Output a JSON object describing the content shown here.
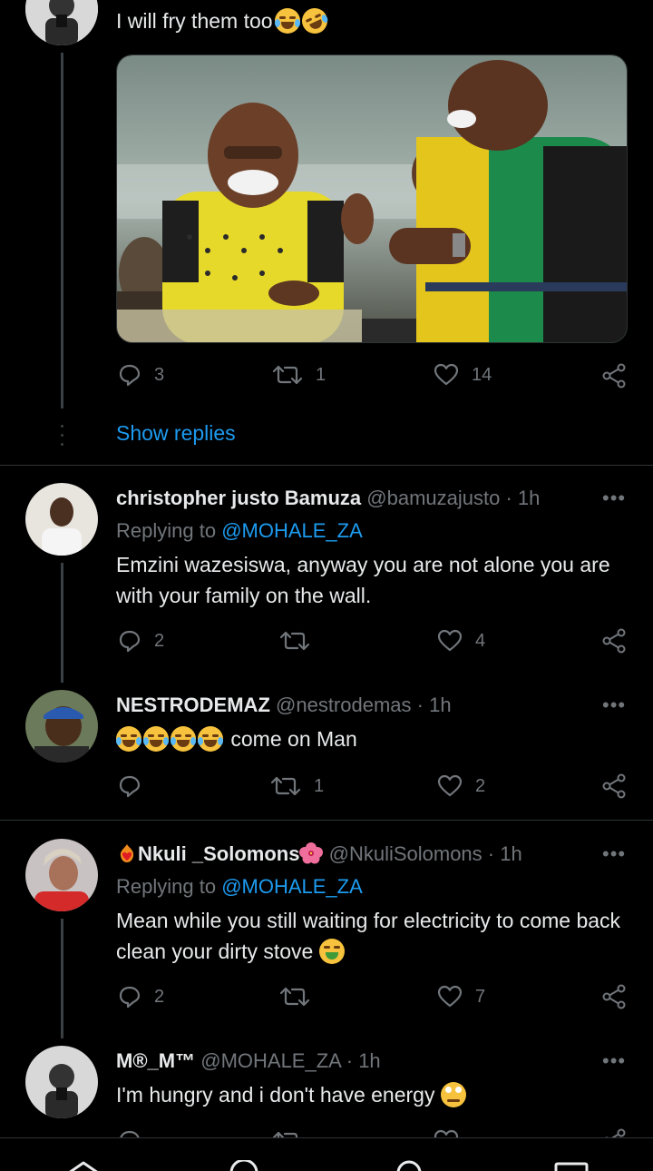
{
  "tweet_main": {
    "text": "I will fry them too",
    "emoji": [
      "face-with-tears-of-joy",
      "rolling-on-the-floor-laughing"
    ],
    "actions": {
      "replies": "3",
      "retweets": "1",
      "likes": "14"
    },
    "show_replies": "Show replies"
  },
  "replies": [
    {
      "name": "christopher justo Bamuza",
      "handle": "@bamuzajusto",
      "time": "· 1h",
      "replying_prefix": "Replying to ",
      "replying_to": "@MOHALE_ZA",
      "text": "Emzini wazesiswa, anyway you are not alone you are with your family on the wall.",
      "actions": {
        "replies": "2",
        "retweets": "",
        "likes": "4"
      }
    },
    {
      "name": "NESTRODEMAZ",
      "handle": "@nestrodemas",
      "time": "· 1h",
      "text": "come on Man",
      "emoji": [
        "face-with-tears-of-joy",
        "face-with-tears-of-joy",
        "face-with-tears-of-joy",
        "face-with-tears-of-joy"
      ],
      "actions": {
        "replies": "",
        "retweets": "1",
        "likes": "2"
      }
    },
    {
      "name": "Nkuli _Solomons",
      "handle": "@NkuliSolomons",
      "time": "· 1h",
      "name_emoji": [
        "heart-on-fire",
        "hibiscus"
      ],
      "replying_prefix": "Replying to ",
      "replying_to": "@MOHALE_ZA",
      "text": "Mean while you still waiting for electricity to come back clean your dirty stove",
      "text_emoji": [
        "face-vomiting"
      ],
      "actions": {
        "replies": "2",
        "retweets": "",
        "likes": "7"
      }
    },
    {
      "name": "M®_M™",
      "handle": "@MOHALE_ZA",
      "time": "· 1h",
      "text": "I'm hungry and i don't have energy",
      "text_emoji": [
        "face-with-rolling-eyes"
      ]
    }
  ],
  "more_label": "•••",
  "colors": {
    "background": "#000000",
    "accent": "#1d9bf0",
    "muted": "#71767b",
    "text": "#e7e9ea"
  }
}
